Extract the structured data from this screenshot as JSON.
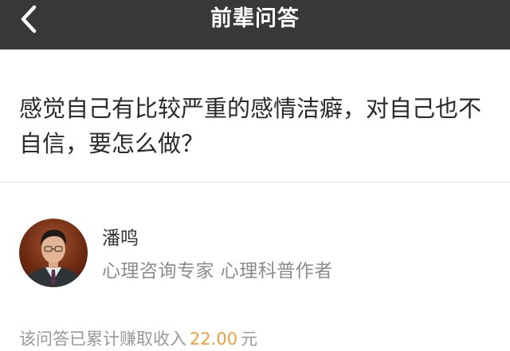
{
  "nav": {
    "back_icon": "chevron-left-icon",
    "title": "前辈问答",
    "background": "#383838"
  },
  "question": {
    "text": "感觉自己有比较严重的感情洁癖，对自己也不自信，要怎么做？"
  },
  "author": {
    "name": "潘鸣",
    "title": "心理咨询专家 心理科普作者"
  },
  "earnings": {
    "prefix": "该问答已累计赚取收入",
    "amount": "22.00",
    "suffix": "元",
    "amount_color": "#e8a040"
  }
}
